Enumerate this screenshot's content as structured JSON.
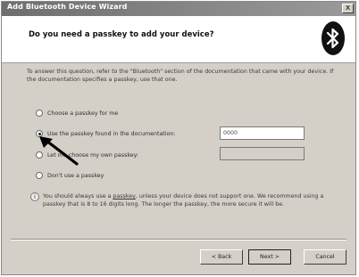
{
  "window": {
    "title": "Add Bluetooth Device Wizard",
    "close_glyph": "x"
  },
  "header": {
    "question": "Do you need a passkey to add your device?",
    "logo_icon": "bluetooth-icon"
  },
  "intro": {
    "text": "To answer this question, refer to the \"Bluetooth\" section of the documentation that came with your device. If the documentation specifies a passkey, use that one."
  },
  "options": [
    {
      "label": "Choose a passkey for me",
      "selected": false
    },
    {
      "label": "Use the passkey found in the documentation:",
      "selected": true,
      "value": "0000"
    },
    {
      "label": "Let me choose my own passkey:",
      "selected": false,
      "value": ""
    },
    {
      "label": "Don't use a passkey",
      "selected": false
    }
  ],
  "info": {
    "icon": "info-icon",
    "text_before": "You should always use a ",
    "link": "passkey",
    "text_after": ", unless your device does not support one. We recommend using a passkey that is 8 to 16 digits long. The longer the passkey, the more secure it will be."
  },
  "buttons": {
    "back": "< Back",
    "next": "Next >",
    "cancel": "Cancel"
  },
  "annotation": {
    "icon": "pointer-arrow-icon"
  }
}
